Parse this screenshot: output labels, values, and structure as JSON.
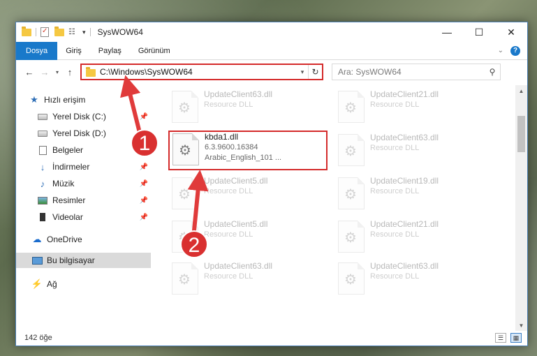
{
  "window": {
    "title": "SysWOW64",
    "controls": {
      "minimize": "—",
      "maximize": "☐",
      "close": "✕"
    }
  },
  "ribbon": {
    "tabs": [
      "Dosya",
      "Giriş",
      "Paylaş",
      "Görünüm"
    ],
    "help": "?"
  },
  "navigation": {
    "back": "←",
    "forward": "→",
    "recent": "▾",
    "up": "↑",
    "address": "C:\\Windows\\SysWOW64",
    "refresh": "↻",
    "search_placeholder": "Ara: SysWOW64"
  },
  "sidebar": {
    "items": [
      {
        "label": "Hızlı erişim",
        "icon": "star-icon",
        "pinned": false
      },
      {
        "label": "Yerel Disk (C:)",
        "icon": "drive-icon",
        "pinned": true
      },
      {
        "label": "Yerel Disk (D:)",
        "icon": "drive-icon",
        "pinned": true
      },
      {
        "label": "Belgeler",
        "icon": "document-icon",
        "pinned": true
      },
      {
        "label": "İndirmeler",
        "icon": "download-icon",
        "pinned": true
      },
      {
        "label": "Müzik",
        "icon": "music-icon",
        "pinned": true
      },
      {
        "label": "Resimler",
        "icon": "pictures-icon",
        "pinned": true
      },
      {
        "label": "Videolar",
        "icon": "video-icon",
        "pinned": true
      },
      {
        "label": "OneDrive",
        "icon": "cloud-icon",
        "pinned": false
      },
      {
        "label": "Bu bilgisayar",
        "icon": "computer-icon",
        "pinned": false,
        "selected": true
      },
      {
        "label": "Ağ",
        "icon": "network-icon",
        "pinned": false
      }
    ]
  },
  "files": {
    "left_column": [
      {
        "name": "UpdateClient63.dll",
        "sub": "Resource DLL"
      },
      {
        "name": "kbda1.dll",
        "version": "6.3.9600.16384",
        "description": "Arabic_English_101 ...",
        "highlighted": true
      },
      {
        "name": "UpdateClient5.dll",
        "sub": "Resource DLL"
      },
      {
        "name": "UpdateClient5.dll",
        "sub": "Resource DLL"
      },
      {
        "name": "UpdateClient63.dll",
        "sub": "Resource DLL"
      }
    ],
    "right_column": [
      {
        "name": "UpdateClient21.dll",
        "sub": "Resource DLL"
      },
      {
        "name": "UpdateClient63.dll",
        "sub": "Resource DLL"
      },
      {
        "name": "UpdateClient19.dll",
        "sub": "Resource DLL"
      },
      {
        "name": "UpdateClient21.dll",
        "sub": "Resource DLL"
      },
      {
        "name": "UpdateClient63.dll",
        "sub": "Resource DLL"
      }
    ]
  },
  "status": {
    "count": "142 öğe"
  },
  "annotations": {
    "step1": "1",
    "step2": "2",
    "arrow_color": "#e03b3b",
    "badge_color": "#d93030"
  },
  "colors": {
    "accent": "#1979ca",
    "highlight_border": "#d42a2a"
  }
}
